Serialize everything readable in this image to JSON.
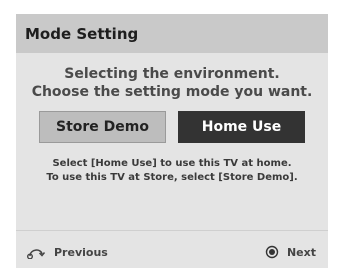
{
  "dialog": {
    "title": "Mode Setting",
    "prompt_line1": "Selecting the environment.",
    "prompt_line2": "Choose the setting mode you want.",
    "buttons": {
      "store_demo": "Store Demo",
      "home_use": "Home Use"
    },
    "hint_line1": "Select [Home Use] to use this TV at home.",
    "hint_line2": "To use this TV at Store, select [Store Demo]."
  },
  "footer": {
    "previous_label": "Previous",
    "previous_icon": "return-arrow-icon",
    "next_label": "Next",
    "next_icon": "ok-button-icon"
  },
  "colors": {
    "title_bar": "#c9c9c9",
    "panel": "#e4e4e4",
    "selected_button": "#333333",
    "unselected_button": "#bdbdbd"
  }
}
